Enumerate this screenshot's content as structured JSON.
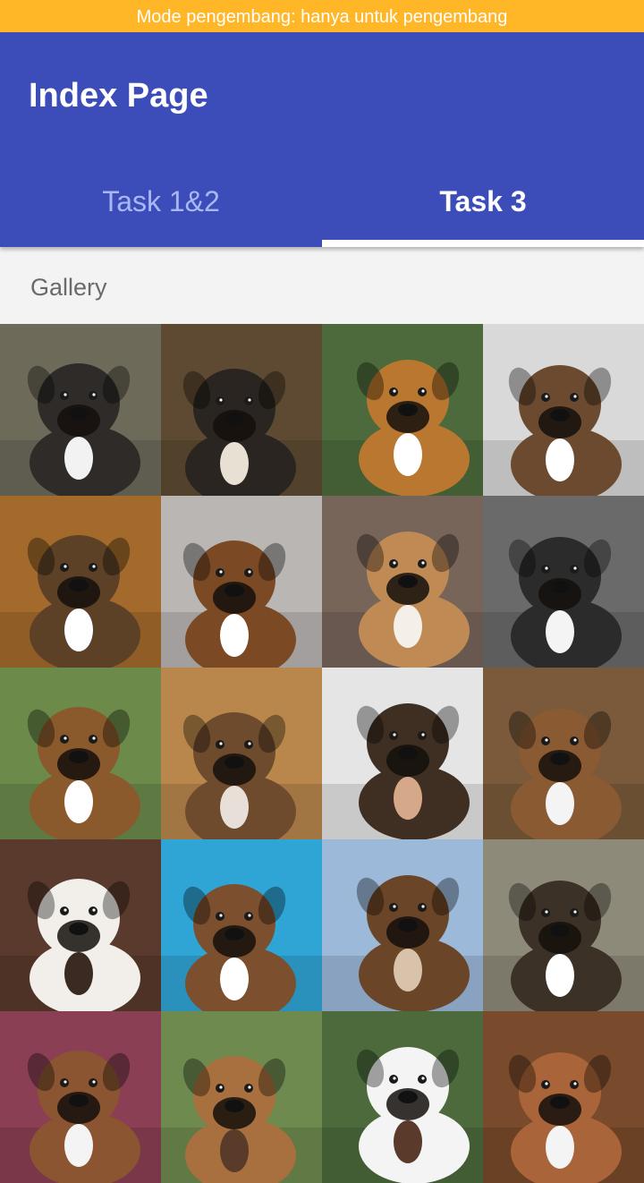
{
  "status_bar": {
    "text": "Mode pengembang: hanya untuk pengembang"
  },
  "app_bar": {
    "title": "Index Page"
  },
  "tabs": [
    {
      "label": "Task 1&2",
      "selected": false
    },
    {
      "label": "Task 3",
      "selected": true
    }
  ],
  "gallery": {
    "header": "Gallery",
    "photos": [
      {
        "bg": "#6d6a5a",
        "fur": "#2e2b28",
        "chest": "#f2f2f2",
        "subject": "brindle-puppy"
      },
      {
        "bg": "#5e4a32",
        "fur": "#2a2520",
        "chest": "#e8e0d2",
        "subject": "black-boxer"
      },
      {
        "bg": "#4d6a3c",
        "fur": "#b9772f",
        "chest": "#ffffff",
        "subject": "fawn-boxer-on-pillow"
      },
      {
        "bg": "#d9d9d9",
        "fur": "#6b4a2f",
        "chest": "#ffffff",
        "subject": "brindle-boxer-standing"
      },
      {
        "bg": "#a46a2c",
        "fur": "#5c4127",
        "chest": "#ffffff",
        "subject": "brindle-puppy-lying"
      },
      {
        "bg": "#b9b6b4",
        "fur": "#7b4a25",
        "chest": "#ffffff",
        "subject": "brown-boxer-sitting"
      },
      {
        "bg": "#77655a",
        "fur": "#c08a55",
        "chest": "#f4efe8",
        "subject": "boxer-in-room"
      },
      {
        "bg": "#6a6a6a",
        "fur": "#2b2b2b",
        "chest": "#f4f4f4",
        "subject": "boxer-red-cap"
      },
      {
        "bg": "#6c8a4a",
        "fur": "#8a5a2c",
        "chest": "#ffffff",
        "subject": "fawn-boxer-face"
      },
      {
        "bg": "#b9874c",
        "fur": "#6f4b2e",
        "chest": "#e8e0d8",
        "subject": "two-boxers-floor"
      },
      {
        "bg": "#e5e5e5",
        "fur": "#3f2f22",
        "chest": "#d6a88a",
        "subject": "brindle-boxer-play"
      },
      {
        "bg": "#7a5a3a",
        "fur": "#8a5a33",
        "chest": "#f4f4f4",
        "subject": "boxer-closeup"
      },
      {
        "bg": "#5a3a2c",
        "fur": "#f2efea",
        "chest": "#3a2a22",
        "subject": "white-boxer-face"
      },
      {
        "bg": "#2fa5d6",
        "fur": "#7c4f2e",
        "chest": "#ffffff",
        "subject": "boxer-blue-hat"
      },
      {
        "bg": "#9cb9da",
        "fur": "#6b4528",
        "chest": "#d8c2aa",
        "subject": "boxer-sky"
      },
      {
        "bg": "#8e8a7a",
        "fur": "#3c3126",
        "chest": "#ffffff",
        "subject": "boxer-garden"
      },
      {
        "bg": "#8b3f55",
        "fur": "#8a5530",
        "chest": "#f4f4f4",
        "subject": "boxer-blue-collar"
      },
      {
        "bg": "#6e8a4f",
        "fur": "#a8703e",
        "chest": "#5a3a28",
        "subject": "boxer-tongue"
      },
      {
        "bg": "#4c6a3c",
        "fur": "#f4f4f4",
        "chest": "#5a3a2a",
        "subject": "white-boxer-red-collar"
      },
      {
        "bg": "#7a4a2c",
        "fur": "#a9643a",
        "chest": "#f4f4f4",
        "subject": "boxer-closeup-2"
      }
    ]
  }
}
